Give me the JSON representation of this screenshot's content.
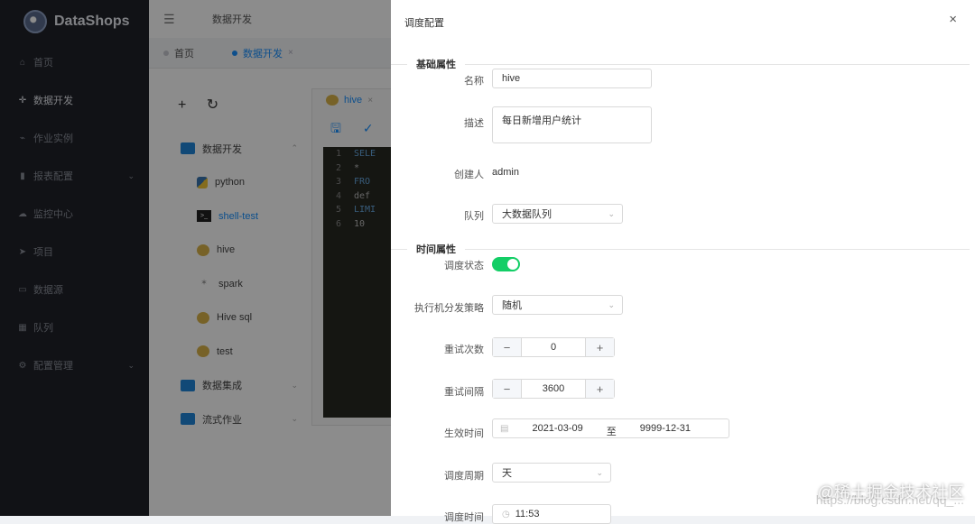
{
  "app": {
    "name": "DataShops"
  },
  "sidebar": {
    "items": [
      {
        "label": "首页",
        "icon": "home-icon"
      },
      {
        "label": "数据开发",
        "icon": "crosshair-icon",
        "active": true
      },
      {
        "label": "作业实例",
        "icon": "chart-line-icon"
      },
      {
        "label": "报表配置",
        "icon": "bar-chart-icon",
        "expandable": true
      },
      {
        "label": "监控中心",
        "icon": "cloud-icon"
      },
      {
        "label": "项目",
        "icon": "send-icon"
      },
      {
        "label": "数据源",
        "icon": "monitor-icon"
      },
      {
        "label": "队列",
        "icon": "grid-icon"
      },
      {
        "label": "配置管理",
        "icon": "gear-icon",
        "expandable": true
      }
    ]
  },
  "topbar": {
    "title": "数据开发"
  },
  "tabs": [
    {
      "label": "首页"
    },
    {
      "label": "数据开发",
      "active": true,
      "close": "×"
    }
  ],
  "tree": {
    "tools": {
      "add": "+",
      "refresh": "↻"
    },
    "items": [
      {
        "label": "数据开发",
        "type": "folder"
      },
      {
        "label": "python",
        "type": "python"
      },
      {
        "label": "shell-test",
        "type": "shell",
        "selected": true
      },
      {
        "label": "hive",
        "type": "hive"
      },
      {
        "label": "spark",
        "type": "spark"
      },
      {
        "label": "Hive sql",
        "type": "hive"
      },
      {
        "label": "test",
        "type": "hive"
      },
      {
        "label": "数据集成",
        "type": "folder"
      },
      {
        "label": "流式作业",
        "type": "folder"
      }
    ]
  },
  "editor": {
    "tab": "hive",
    "tab_close": "×",
    "lines": [
      {
        "n": "1",
        "text": "SELE"
      },
      {
        "n": "2",
        "text": " *"
      },
      {
        "n": "3",
        "text": "FRO"
      },
      {
        "n": "4",
        "text": " def"
      },
      {
        "n": "5",
        "text": "LIMI"
      },
      {
        "n": "6",
        "text": " 10"
      }
    ]
  },
  "drawer": {
    "title": "调度配置",
    "close": "×",
    "basic_section": "基础属性",
    "time_section": "时间属性",
    "name_label": "名称",
    "name_value": "hive",
    "desc_label": "描述",
    "desc_value": "每日新增用户统计",
    "creator_label": "创建人",
    "creator_value": "admin",
    "queue_label": "队列",
    "queue_value": "大数据队列",
    "status_label": "调度状态",
    "status_on": true,
    "strategy_label": "执行机分发策略",
    "strategy_value": "随机",
    "retry_label": "重试次数",
    "retry_value": "0",
    "interval_label": "重试间隔",
    "interval_value": "3600",
    "effective_label": "生效时间",
    "start_date": "2021-03-09",
    "range_sep": "至",
    "end_date": "9999-12-31",
    "cycle_label": "调度周期",
    "cycle_value": "天",
    "time_label": "调度时间",
    "time_value": "11:53",
    "stepper_minus": "−",
    "stepper_plus": "+"
  },
  "watermark": {
    "text": "@稀土掘金技术社区",
    "url": "https://blog.csdn.net/qq_..."
  },
  "colors": {
    "accent": "#1890ff",
    "switch_on": "#13ce66",
    "sidebar_bg": "#1f2229"
  }
}
